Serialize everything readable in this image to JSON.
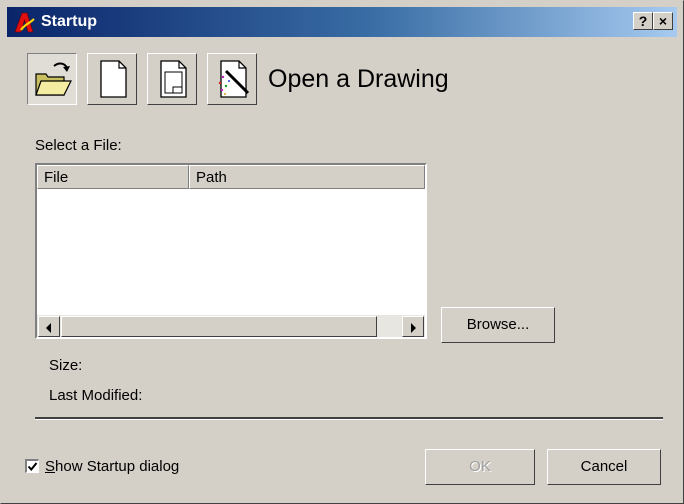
{
  "window": {
    "title": "Startup",
    "help_button": "?",
    "close_button": "×"
  },
  "toolbar": {
    "modes": [
      {
        "name": "open-drawing",
        "icon": "open-folder-icon",
        "selected": true
      },
      {
        "name": "start-from-scratch",
        "icon": "blank-page-icon",
        "selected": false
      },
      {
        "name": "use-template",
        "icon": "template-page-icon",
        "selected": false
      },
      {
        "name": "use-wizard",
        "icon": "wizard-icon",
        "selected": false
      }
    ]
  },
  "main": {
    "heading": "Open a Drawing",
    "select_file_label": "Select a File:",
    "columns": [
      "File",
      "Path"
    ],
    "rows": [],
    "browse_label": "Browse...",
    "size_label": "Size:",
    "last_modified_label": "Last Modified:"
  },
  "footer": {
    "show_startup_label": "Show Startup dialog",
    "show_startup_checked": true,
    "ok_label": "OK",
    "ok_enabled": false,
    "cancel_label": "Cancel"
  }
}
